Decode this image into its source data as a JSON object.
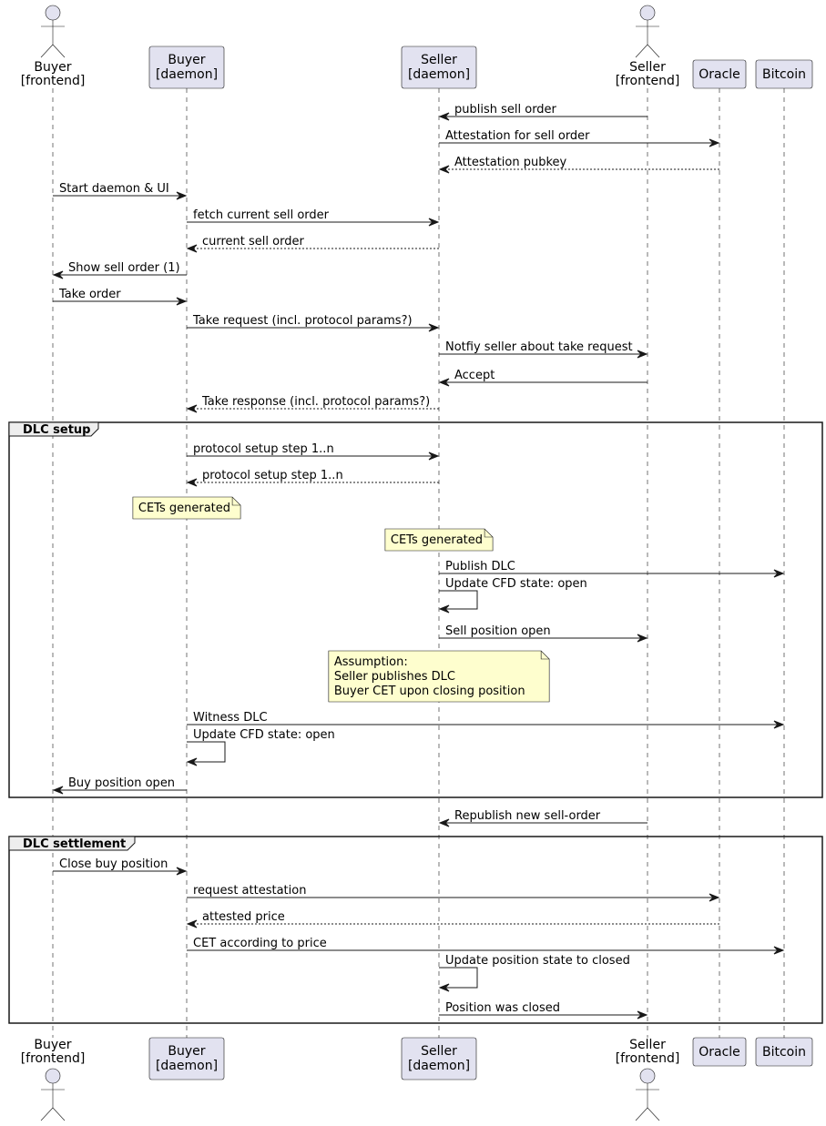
{
  "participants": [
    {
      "id": "buyer_frontend",
      "kind": "actor",
      "lines": [
        "Buyer",
        "[frontend]"
      ]
    },
    {
      "id": "buyer_daemon",
      "kind": "box",
      "lines": [
        "Buyer",
        "[daemon]"
      ]
    },
    {
      "id": "seller_daemon",
      "kind": "box",
      "lines": [
        "Seller",
        "[daemon]"
      ]
    },
    {
      "id": "seller_frontend",
      "kind": "actor",
      "lines": [
        "Seller",
        "[frontend]"
      ]
    },
    {
      "id": "oracle",
      "kind": "box",
      "lines": [
        "Oracle"
      ]
    },
    {
      "id": "bitcoin",
      "kind": "box",
      "lines": [
        "Bitcoin"
      ]
    }
  ],
  "colors": {
    "participant_fill": "#e2e2f0",
    "participant_stroke": "#181818",
    "note_fill": "#fefece",
    "group_header_fill": "#eeeeee",
    "line": "#181818"
  },
  "events": [
    {
      "type": "msg",
      "from": "seller_frontend",
      "to": "seller_daemon",
      "label": "publish sell order",
      "style": "solid"
    },
    {
      "type": "msg",
      "from": "seller_daemon",
      "to": "oracle",
      "label": "Attestation for sell order",
      "style": "solid"
    },
    {
      "type": "msg",
      "from": "oracle",
      "to": "seller_daemon",
      "label": "Attestation pubkey",
      "style": "dashed"
    },
    {
      "type": "msg",
      "from": "buyer_frontend",
      "to": "buyer_daemon",
      "label": "Start daemon & UI",
      "style": "solid"
    },
    {
      "type": "msg",
      "from": "buyer_daemon",
      "to": "seller_daemon",
      "label": "fetch current sell order",
      "style": "solid"
    },
    {
      "type": "msg",
      "from": "seller_daemon",
      "to": "buyer_daemon",
      "label": "current sell order",
      "style": "dashed"
    },
    {
      "type": "msg",
      "from": "buyer_daemon",
      "to": "buyer_frontend",
      "label": "Show sell order (1)",
      "style": "solid"
    },
    {
      "type": "msg",
      "from": "buyer_frontend",
      "to": "buyer_daemon",
      "label": "Take order",
      "style": "solid"
    },
    {
      "type": "msg",
      "from": "buyer_daemon",
      "to": "seller_daemon",
      "label": "Take request (incl. protocol params?)",
      "style": "solid"
    },
    {
      "type": "msg",
      "from": "seller_daemon",
      "to": "seller_frontend",
      "label": "Notfiy seller about take request",
      "style": "solid"
    },
    {
      "type": "msg",
      "from": "seller_frontend",
      "to": "seller_daemon",
      "label": "Accept",
      "style": "solid"
    },
    {
      "type": "msg",
      "from": "seller_daemon",
      "to": "buyer_daemon",
      "label": "Take response (incl. protocol params?)",
      "style": "dashed"
    },
    {
      "type": "group_start",
      "label": "DLC setup"
    },
    {
      "type": "msg",
      "from": "buyer_daemon",
      "to": "seller_daemon",
      "label": "protocol setup step 1..n",
      "style": "solid"
    },
    {
      "type": "msg",
      "from": "seller_daemon",
      "to": "buyer_daemon",
      "label": "protocol setup step 1..n",
      "style": "dashed"
    },
    {
      "type": "note",
      "over": "buyer_daemon",
      "lines": [
        "CETs generated"
      ]
    },
    {
      "type": "note",
      "over": "seller_daemon",
      "lines": [
        "CETs generated"
      ]
    },
    {
      "type": "msg",
      "from": "seller_daemon",
      "to": "bitcoin",
      "label": "Publish DLC",
      "style": "solid"
    },
    {
      "type": "self",
      "on": "seller_daemon",
      "label": "Update CFD state: open"
    },
    {
      "type": "msg",
      "from": "seller_daemon",
      "to": "seller_frontend",
      "label": "Sell position open",
      "style": "solid"
    },
    {
      "type": "note",
      "over": "seller_daemon",
      "lines": [
        "Assumption:",
        "Seller publishes DLC",
        "Buyer CET upon closing position"
      ]
    },
    {
      "type": "msg",
      "from": "buyer_daemon",
      "to": "bitcoin",
      "label": "Witness DLC",
      "style": "solid"
    },
    {
      "type": "self",
      "on": "buyer_daemon",
      "label": "Update CFD state: open"
    },
    {
      "type": "msg",
      "from": "buyer_daemon",
      "to": "buyer_frontend",
      "label": "Buy position open",
      "style": "solid"
    },
    {
      "type": "group_end"
    },
    {
      "type": "msg",
      "from": "seller_frontend",
      "to": "seller_daemon",
      "label": "Republish new sell-order",
      "style": "solid"
    },
    {
      "type": "group_start",
      "label": "DLC settlement"
    },
    {
      "type": "msg",
      "from": "buyer_frontend",
      "to": "buyer_daemon",
      "label": "Close buy position",
      "style": "solid"
    },
    {
      "type": "msg",
      "from": "buyer_daemon",
      "to": "oracle",
      "label": "request attestation",
      "style": "solid"
    },
    {
      "type": "msg",
      "from": "oracle",
      "to": "buyer_daemon",
      "label": "attested price",
      "style": "dashed"
    },
    {
      "type": "msg",
      "from": "buyer_daemon",
      "to": "bitcoin",
      "label": "CET according to price",
      "style": "solid"
    },
    {
      "type": "self",
      "on": "seller_daemon",
      "label": "Update position state to closed"
    },
    {
      "type": "msg",
      "from": "seller_daemon",
      "to": "seller_frontend",
      "label": "Position was closed",
      "style": "solid"
    },
    {
      "type": "group_end"
    }
  ]
}
